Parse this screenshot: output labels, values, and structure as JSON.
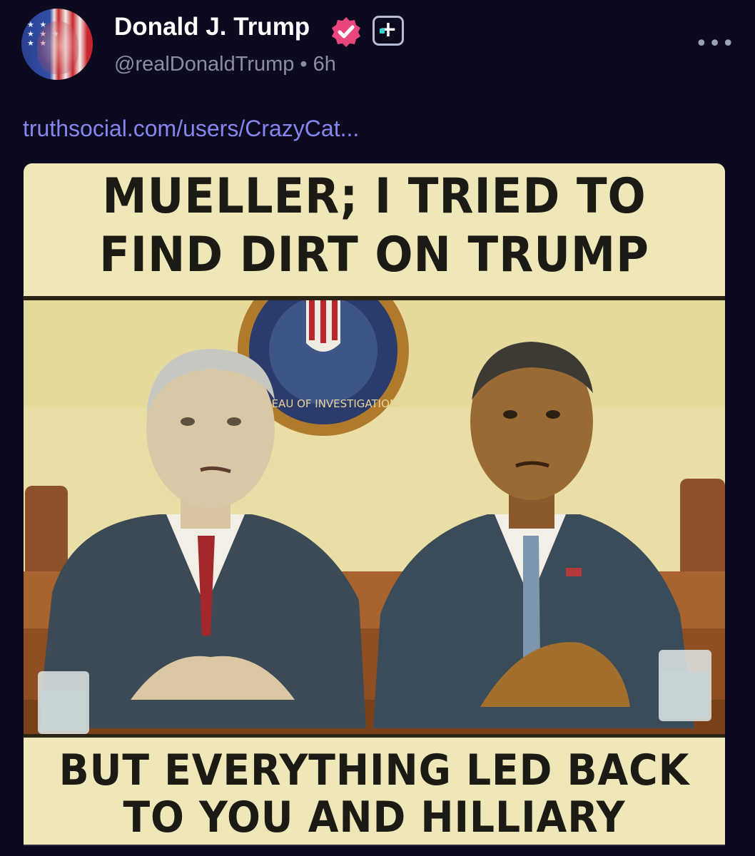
{
  "post": {
    "author": {
      "display_name": "Donald J. Trump",
      "handle": "@realDonaldTrump",
      "time": "6h",
      "verified_icon": "verified-badge-icon",
      "plus_icon": "plus-badge-icon"
    },
    "more_label": "•••",
    "separator": "•",
    "link_text": "truthsocial.com/users/CrazyCat...",
    "meme": {
      "top_line_1": "MUELLER; I TRIED TO",
      "top_line_2": "FIND DIRT ON TRUMP",
      "bottom_line_1": "BUT EVERYTHING LED BACK",
      "bottom_line_2": "TO YOU AND HILLIARY",
      "seal_text": "BUREAU OF INVESTIGATION"
    }
  },
  "colors": {
    "background": "#0c0a1e",
    "link": "#8686f0",
    "verified": "#e8467c",
    "handle": "#8c8ca4"
  }
}
